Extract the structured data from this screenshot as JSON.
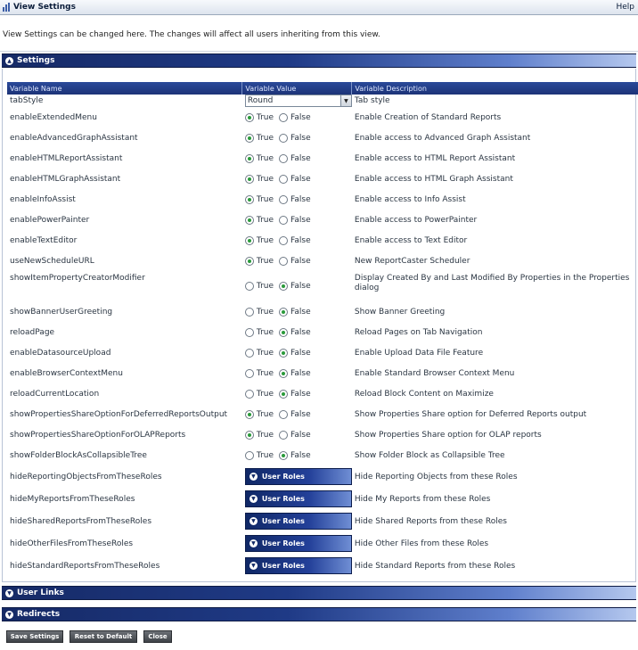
{
  "window": {
    "title": "View Settings",
    "help_label": "Help"
  },
  "intro_text": "View Settings can be changed here. The changes will affect all users inheriting from this view.",
  "panels": {
    "settings": "Settings",
    "user_links": "User Links",
    "redirects": "Redirects"
  },
  "table": {
    "headers": [
      "Variable Name",
      "Variable Value",
      "Variable Description"
    ],
    "tabstyle": {
      "name": "tabStyle",
      "value": "Round",
      "desc": "Tab style"
    },
    "true_label": "True",
    "false_label": "False",
    "bool_rows": [
      {
        "name": "enableExtendedMenu",
        "value": true,
        "desc": "Enable Creation of Standard Reports"
      },
      {
        "name": "enableAdvancedGraphAssistant",
        "value": true,
        "desc": "Enable access to Advanced Graph Assistant"
      },
      {
        "name": "enableHTMLReportAssistant",
        "value": true,
        "desc": "Enable access to HTML Report Assistant"
      },
      {
        "name": "enableHTMLGraphAssistant",
        "value": true,
        "desc": "Enable access to HTML Graph Assistant"
      },
      {
        "name": "enableInfoAssist",
        "value": true,
        "desc": "Enable access to Info Assist"
      },
      {
        "name": "enablePowerPainter",
        "value": true,
        "desc": "Enable access to PowerPainter"
      },
      {
        "name": "enableTextEditor",
        "value": true,
        "desc": "Enable access to Text Editor"
      },
      {
        "name": "useNewScheduleURL",
        "value": true,
        "desc": "New ReportCaster Scheduler"
      },
      {
        "name": "showItemPropertyCreatorModifier",
        "value": false,
        "desc": "Display Created By and Last Modified By Properties in the Properties dialog",
        "tall": true
      },
      {
        "name": "showBannerUserGreeting",
        "value": false,
        "desc": "Show Banner Greeting"
      },
      {
        "name": "reloadPage",
        "value": false,
        "desc": "Reload Pages on Tab Navigation"
      },
      {
        "name": "enableDatasourceUpload",
        "value": false,
        "desc": "Enable Upload Data File Feature"
      },
      {
        "name": "enableBrowserContextMenu",
        "value": false,
        "desc": "Enable Standard Browser Context Menu"
      },
      {
        "name": "reloadCurrentLocation",
        "value": false,
        "desc": "Reload Block Content on Maximize"
      },
      {
        "name": "showPropertiesShareOptionForDeferredReportsOutput",
        "value": true,
        "desc": "Show Properties Share option for Deferred Reports output"
      },
      {
        "name": "showPropertiesShareOptionForOLAPReports",
        "value": true,
        "desc": "Show Properties Share option for OLAP reports"
      },
      {
        "name": "showFolderBlockAsCollapsibleTree",
        "value": false,
        "desc": "Show Folder Block as Collapsible Tree"
      }
    ],
    "user_roles_label": "User Roles",
    "role_rows": [
      {
        "name": "hideReportingObjectsFromTheseRoles",
        "desc": "Hide Reporting Objects from these Roles"
      },
      {
        "name": "hideMyReportsFromTheseRoles",
        "desc": "Hide My Reports from these Roles"
      },
      {
        "name": "hideSharedReportsFromTheseRoles",
        "desc": "Hide Shared Reports from these Roles"
      },
      {
        "name": "hideOtherFilesFromTheseRoles",
        "desc": "Hide Other Files from these Roles"
      },
      {
        "name": "hideStandardReportsFromTheseRoles",
        "desc": "Hide Standard Reports from these Roles"
      }
    ]
  },
  "footer": {
    "save": "Save Settings",
    "reset": "Reset to Default",
    "close": "Close"
  }
}
